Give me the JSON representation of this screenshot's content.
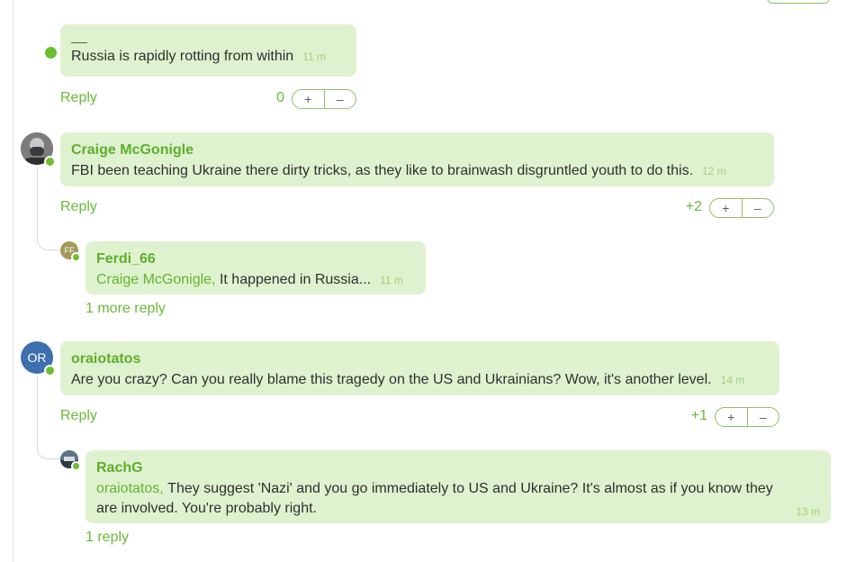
{
  "comments": [
    {
      "author": "",
      "text": "Russia is rapidly rotting from within",
      "time": "11 m",
      "reply_label": "Reply",
      "score": "0",
      "vote_up": "+",
      "vote_down": "–"
    },
    {
      "author": "Craige McGonigle",
      "text": "FBI been teaching Ukraine there dirty tricks, as they like to brainwash disgruntled youth to do this.",
      "time": "12 m",
      "reply_label": "Reply",
      "score": "+2",
      "vote_up": "+",
      "vote_down": "–",
      "replies": [
        {
          "author": "Ferdi_66",
          "avatar_initials": "FF",
          "mention": "Craige McGonigle,",
          "text": "It happened in Russia...",
          "time": "11 m",
          "more_label": "1 more reply"
        }
      ]
    },
    {
      "author": "oraiotatos",
      "avatar_initials": "OR",
      "text": "Are you crazy? Can you really blame this tragedy on the US and Ukrainians? Wow, it's another level.",
      "time": "14 m",
      "reply_label": "Reply",
      "score": "+1",
      "vote_up": "+",
      "vote_down": "–",
      "replies": [
        {
          "author": "RachG",
          "mention": "oraiotatos,",
          "text": "They suggest 'Nazi' and you go immediately to US and Ukraine? It's almost as if you know they are involved. You're probably right.",
          "time": "13 m",
          "more_label": "1 reply"
        }
      ]
    }
  ],
  "colors": {
    "bubble": "#dff2cf",
    "accent": "#6bb83a",
    "online": "#6bc02f",
    "avatar_or": "#3e6fae",
    "avatar_ff": "#a39a5a"
  }
}
